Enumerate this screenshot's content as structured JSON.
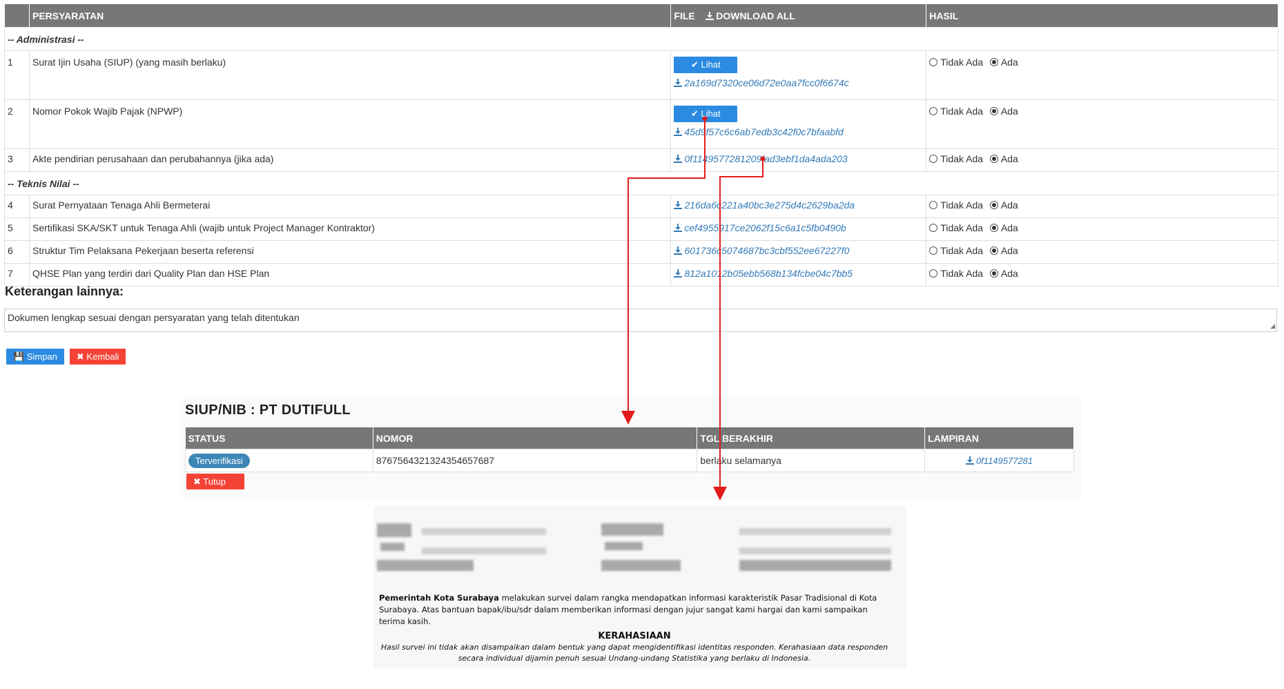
{
  "table": {
    "headers": {
      "persyaratan": "PERSYARATAN",
      "file": "FILE",
      "download_all": "DOWNLOAD ALL",
      "hasil": "HASIL"
    },
    "sections": [
      {
        "label": "-- Administrasi --"
      },
      {
        "label": "-- Teknis Nilai --"
      }
    ],
    "rows": [
      {
        "no": "1",
        "desc": "Surat Ijin Usaha (SIUP) (yang masih berlaku)",
        "lihat": "Lihat",
        "file": "2a169d7320ce06d72e0aa7fcc0f6674c",
        "opt_no": "Tidak Ada",
        "opt_yes": "Ada"
      },
      {
        "no": "2",
        "desc": "Nomor Pokok Wajib Pajak (NPWP)",
        "lihat": "Lihat",
        "file": "45d9f57c6c6ab7edb3c42f0c7bfaabfd",
        "opt_no": "Tidak Ada",
        "opt_yes": "Ada"
      },
      {
        "no": "3",
        "desc": "Akte pendirian perusahaan dan perubahannya (jika ada)",
        "file": "0f1149577281209fad3ebf1da4ada203",
        "opt_no": "Tidak Ada",
        "opt_yes": "Ada"
      },
      {
        "no": "4",
        "desc": "Surat Pernyataan Tenaga Ahli Bermeterai",
        "file": "216da6c221a40bc3e275d4c2629ba2da",
        "opt_no": "Tidak Ada",
        "opt_yes": "Ada"
      },
      {
        "no": "5",
        "desc": "Sertifikasi SKA/SKT untuk Tenaga Ahli (wajib untuk Project Manager Kontraktor)",
        "file": "cef4955917ce2062f15c6a1c5fb0490b",
        "opt_no": "Tidak Ada",
        "opt_yes": "Ada"
      },
      {
        "no": "6",
        "desc": "Struktur Tim Pelaksana Pekerjaan beserta referensi",
        "file": "601736c5074687bc3cbf552ee67227f0",
        "opt_no": "Tidak Ada",
        "opt_yes": "Ada"
      },
      {
        "no": "7",
        "desc": "QHSE Plan yang terdiri dari Quality Plan dan HSE Plan",
        "file": "812a1012b05ebb568b134fcbe04c7bb5",
        "opt_no": "Tidak Ada",
        "opt_yes": "Ada"
      }
    ]
  },
  "keterangan": {
    "title": "Keterangan lainnya:",
    "value": "Dokumen lengkap sesuai dengan persyaratan yang telah ditentukan"
  },
  "actions": {
    "save": "Simpan",
    "back": "Kembali"
  },
  "modal": {
    "title": "SIUP/NIB : PT DUTIFULL",
    "headers": {
      "status": "STATUS",
      "nomor": "NOMOR",
      "tgl": "TGL BERAKHIR",
      "lampiran": "LAMPIRAN"
    },
    "row": {
      "status": "Terverifikasi",
      "nomor": "8767564321324354657687",
      "tgl": "berlaku selamanya",
      "lampiran": "0f1149577281"
    },
    "close": "Tutup"
  },
  "document": {
    "body_bold": "Pemerintah Kota Surabaya",
    "body": "melakukan survei dalam rangka mendapatkan informasi karakteristik Pasar Tradisional di Kota Surabaya.  Atas bantuan bapak/ibu/sdr dalam memberikan informasi dengan  jujur sangat kami hargai dan kami sampaikan terima kasih.",
    "heading": "KERAHASIAAN",
    "footer": "Hasil survei ini tidak akan disampaikan dalam bentuk yang dapat mengidentifikasi identitas responden. Kerahasiaan data responden secara individual dijamin penuh sesuai Undang-undang Statistika yang berlaku di Indonesia."
  },
  "colors": {
    "header": "#777777",
    "primary": "#2b8ae2",
    "danger": "#f44336",
    "link": "#337ab7",
    "arrow": "#e31b1b"
  }
}
